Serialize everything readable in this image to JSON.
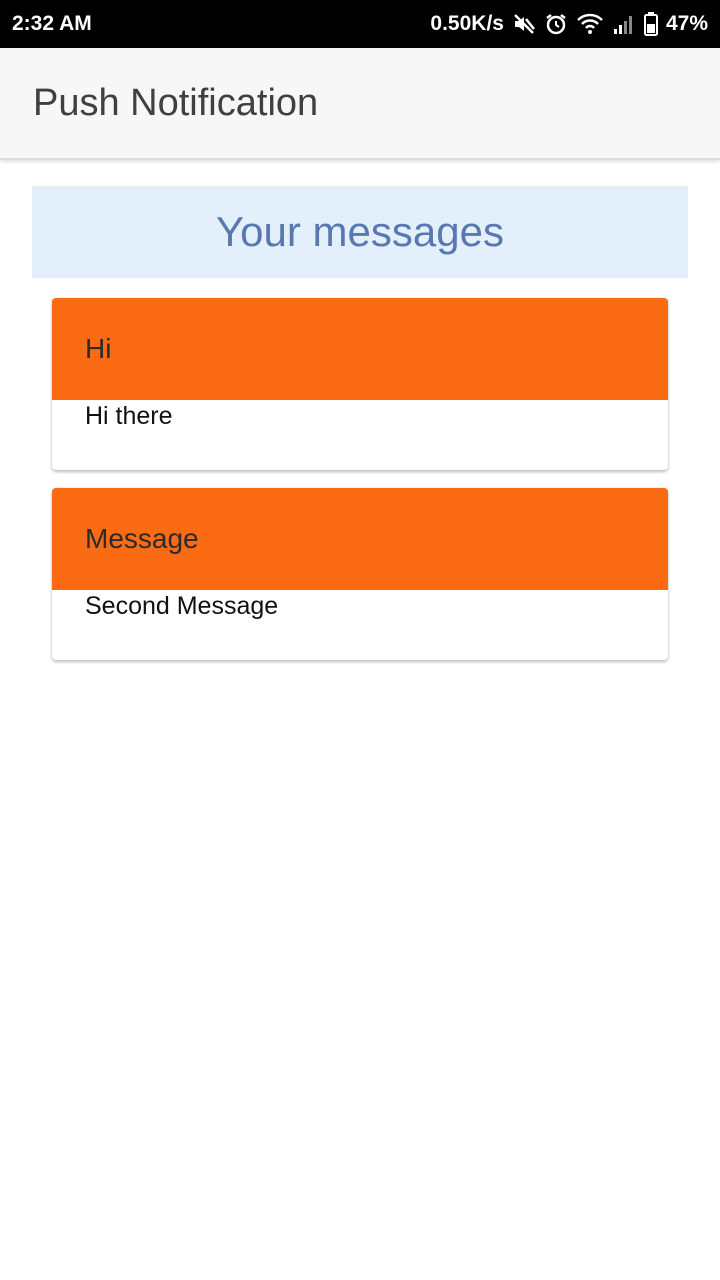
{
  "status_bar": {
    "time": "2:32 AM",
    "network_speed": "0.50K/s",
    "battery": "47%",
    "icons": [
      "mute-icon",
      "alarm-icon",
      "wifi-icon",
      "signal-icon",
      "battery-icon"
    ]
  },
  "app_bar": {
    "title": "Push Notification"
  },
  "banner": {
    "title": "Your messages"
  },
  "messages": [
    {
      "title": "Hi",
      "body": "Hi there"
    },
    {
      "title": "Message",
      "body": "Second Message"
    }
  ],
  "colors": {
    "card_header": "#fb6b14",
    "banner_bg": "#e3effb",
    "banner_text": "#5a78b0"
  }
}
